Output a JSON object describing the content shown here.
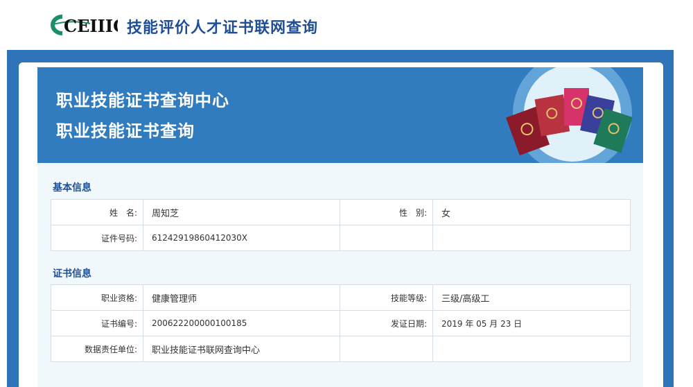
{
  "header": {
    "logo_text": "CEIIIC",
    "site_title": "技能评价人才证书联网查询"
  },
  "banner": {
    "title_line1": "职业技能证书查询中心",
    "title_line2": "职业技能证书查询"
  },
  "basic_info": {
    "section_title": "基本信息",
    "name_label": "姓　名:",
    "name_value": "周知芝",
    "gender_label": "性　别:",
    "gender_value": "女",
    "id_label": "证件号码:",
    "id_value": "61242919860412030X"
  },
  "cert_info": {
    "section_title": "证书信息",
    "qualification_label": "职业资格:",
    "qualification_value": "健康管理师",
    "level_label": "技能等级:",
    "level_value": "三级/高级工",
    "cert_no_label": "证书编号:",
    "cert_no_value": "2006222000001001​85",
    "issue_date_label": "发证日期:",
    "issue_date_value": "2019 年 05 月 23 日",
    "unit_label": "数据责任单位:",
    "unit_value": "职业技能证书联网查询中心"
  },
  "colors": {
    "brand_blue": "#1f4e93",
    "band_blue": "#2f73b8",
    "banner_blue": "#317cbf",
    "logo_green": "#1a8f6a"
  },
  "icons": {
    "logo": "ceiiic-logo",
    "certificate_books": "certificate-books-illustration"
  }
}
